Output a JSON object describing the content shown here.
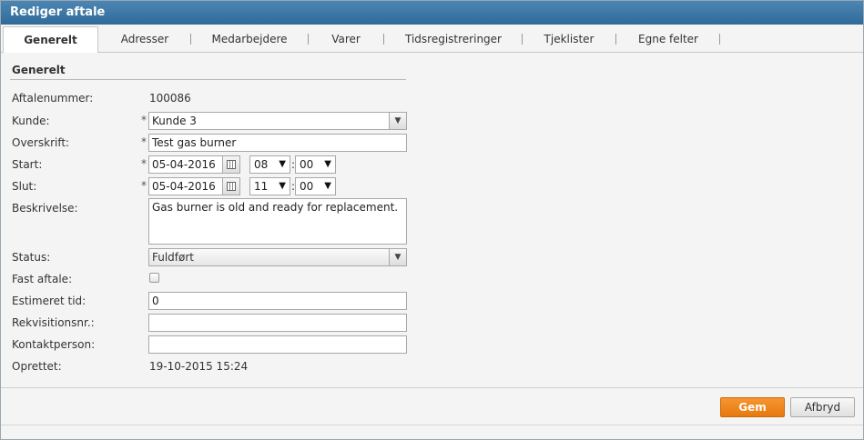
{
  "dialog": {
    "title": "Rediger aftale"
  },
  "tabs": [
    {
      "label": "Generelt"
    },
    {
      "label": "Adresser"
    },
    {
      "label": "Medarbejdere"
    },
    {
      "label": "Varer"
    },
    {
      "label": "Tidsregistreringer"
    },
    {
      "label": "Tjeklister"
    },
    {
      "label": "Egne felter"
    }
  ],
  "section": {
    "title": "Generelt"
  },
  "form": {
    "aftalenummer": {
      "label": "Aftalenummer:",
      "value": "100086"
    },
    "kunde": {
      "label": "Kunde:",
      "value": "Kunde 3",
      "required": "*"
    },
    "overskrift": {
      "label": "Overskrift:",
      "value": "Test gas burner",
      "required": "*"
    },
    "start": {
      "label": "Start:",
      "date": "05-04-2016",
      "hour": "08",
      "minute": "00",
      "required": "*"
    },
    "slut": {
      "label": "Slut:",
      "date": "05-04-2016",
      "hour": "11",
      "minute": "00",
      "required": "*"
    },
    "beskrivelse": {
      "label": "Beskrivelse:",
      "value": "Gas burner is old and ready for replacement."
    },
    "status": {
      "label": "Status:",
      "value": "Fuldført"
    },
    "fast_aftale": {
      "label": "Fast aftale:",
      "checked": false
    },
    "estimeret_tid": {
      "label": "Estimeret tid:",
      "value": "0"
    },
    "rekvisitionsnr": {
      "label": "Rekvisitionsnr.:",
      "value": ""
    },
    "kontaktperson": {
      "label": "Kontaktperson:",
      "value": ""
    },
    "oprettet": {
      "label": "Oprettet:",
      "value": "19-10-2015 15:24"
    },
    "colon": ":"
  },
  "buttons": {
    "save": "Gem",
    "cancel": "Afbryd"
  },
  "colors": {
    "titlebar": "#2f6a98",
    "primary_button": "#e8780f"
  }
}
